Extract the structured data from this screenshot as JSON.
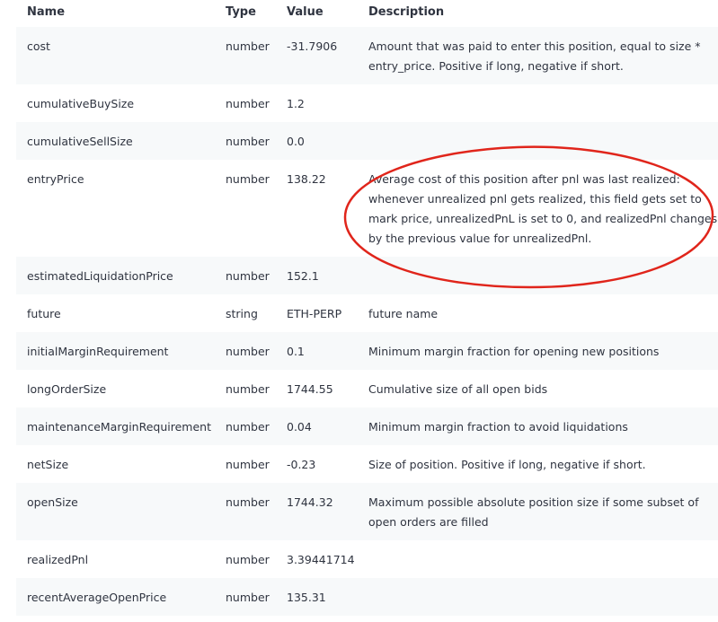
{
  "headers": {
    "name": "Name",
    "type": "Type",
    "value": "Value",
    "description": "Description"
  },
  "rows": [
    {
      "name": "cost",
      "type": "number",
      "value": "-31.7906",
      "description": "Amount that was paid to enter this position, equal to size * entry_price. Positive if long, negative if short."
    },
    {
      "name": "cumulativeBuySize",
      "type": "number",
      "value": "1.2",
      "description": ""
    },
    {
      "name": "cumulativeSellSize",
      "type": "number",
      "value": "0.0",
      "description": ""
    },
    {
      "name": "entryPrice",
      "type": "number",
      "value": "138.22",
      "description": "Average cost of this position after pnl was last realized: whenever unrealized pnl gets realized, this field gets set to mark price, unrealizedPnL is set to 0, and realizedPnl changes by the previous value for unrealizedPnl."
    },
    {
      "name": "estimatedLiquidationPrice",
      "type": "number",
      "value": "152.1",
      "description": ""
    },
    {
      "name": "future",
      "type": "string",
      "value": "ETH-PERP",
      "description": "future name"
    },
    {
      "name": "initialMarginRequirement",
      "type": "number",
      "value": "0.1",
      "description": "Minimum margin fraction for opening new positions"
    },
    {
      "name": "longOrderSize",
      "type": "number",
      "value": "1744.55",
      "description": "Cumulative size of all open bids"
    },
    {
      "name": "maintenanceMarginRequirement",
      "type": "number",
      "value": "0.04",
      "description": "Minimum margin fraction to avoid liquidations"
    },
    {
      "name": "netSize",
      "type": "number",
      "value": "-0.23",
      "description": "Size of position. Positive if long, negative if short."
    },
    {
      "name": "openSize",
      "type": "number",
      "value": "1744.32",
      "description": "Maximum possible absolute position size if some subset of open orders are filled"
    },
    {
      "name": "realizedPnl",
      "type": "number",
      "value": "3.39441714",
      "description": ""
    },
    {
      "name": "recentAverageOpenPrice",
      "type": "number",
      "value": "135.31",
      "description": ""
    }
  ],
  "colors": {
    "text": "#2f3440",
    "alt_row": "#f7f9fa",
    "annotation": "#e0251b"
  }
}
